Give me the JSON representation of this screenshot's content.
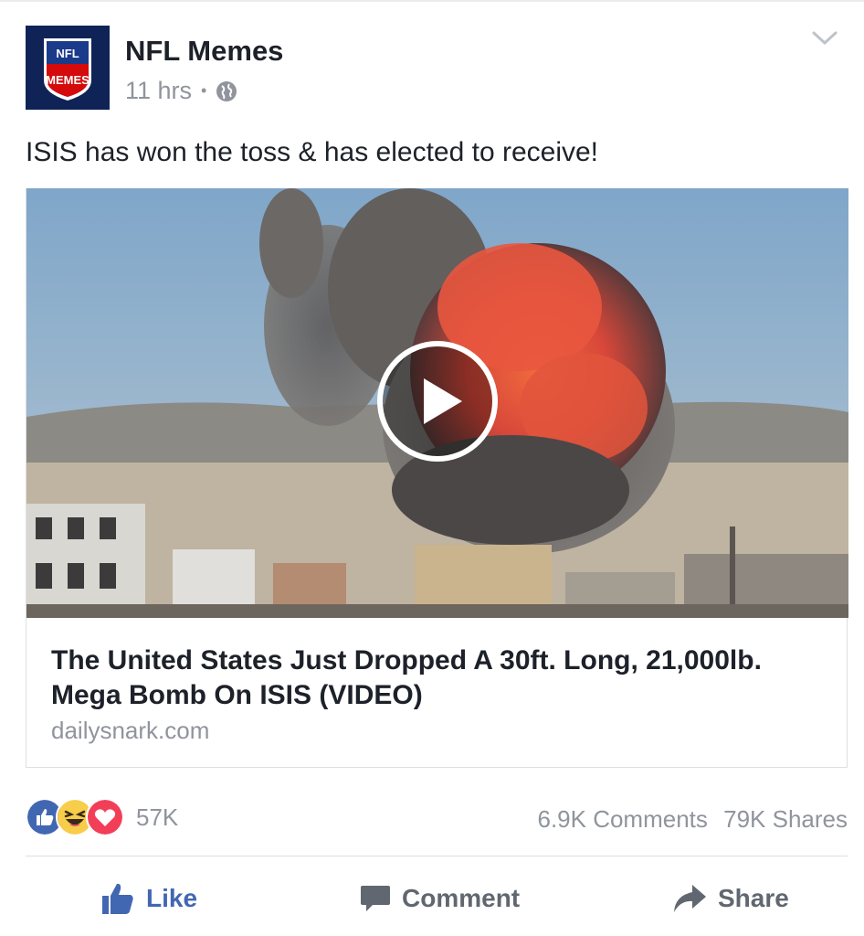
{
  "post": {
    "page_name": "NFL Memes",
    "time": "11 hrs",
    "separator": "•",
    "privacy_icon": "globe-icon",
    "menu_icon": "chevron-down-icon",
    "text": "ISIS has won the toss & has elected to receive!",
    "avatar_text_top": "NFL",
    "avatar_text_main": "MEMES"
  },
  "link_card": {
    "title": "The United States Just Dropped A 30ft. Long, 21,000lb. Mega Bomb On ISIS (VIDEO)",
    "domain": "dailysnark.com",
    "media_icon": "play-icon"
  },
  "stats": {
    "reactions": [
      "like-reaction-icon",
      "haha-reaction-icon",
      "love-reaction-icon"
    ],
    "reaction_count": "57K",
    "comments": "6.9K Comments",
    "shares": "79K Shares"
  },
  "actions": {
    "like": "Like",
    "comment": "Comment",
    "share": "Share"
  },
  "colors": {
    "like_blue": "#4267b2",
    "meta_gray": "#90949c",
    "text_dark": "#1d2129",
    "avatar_navy": "#0f2356",
    "avatar_red": "#d50a0a"
  }
}
